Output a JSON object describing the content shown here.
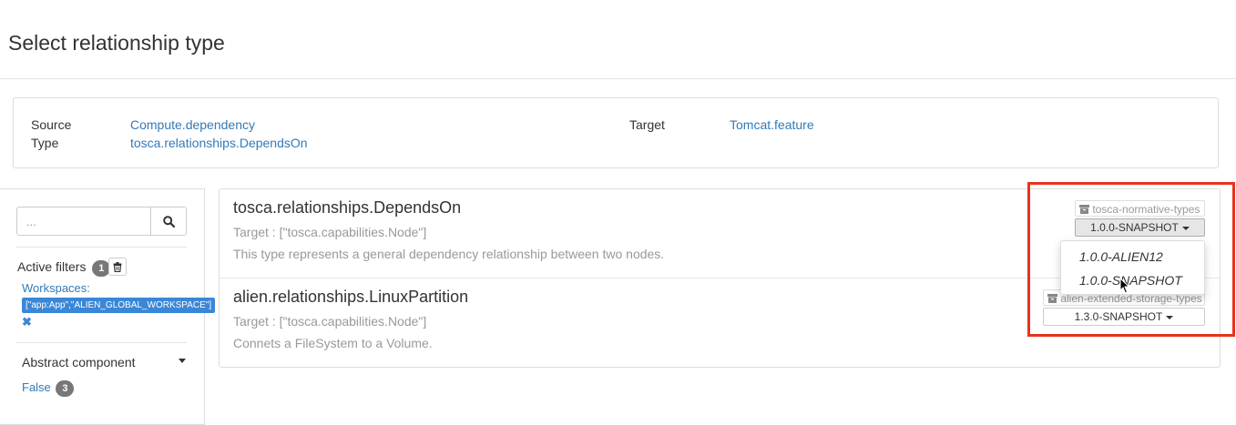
{
  "page": {
    "title": "Select relationship type"
  },
  "info": {
    "source_label": "Source",
    "source_value": "Compute.dependency",
    "type_label": "Type",
    "type_value": "tosca.relationships.DependsOn",
    "target_label": "Target",
    "target_value": "Tomcat.feature"
  },
  "sidebar": {
    "search_placeholder": "...",
    "active_filters_label": "Active filters",
    "active_filters_count": "1",
    "workspaces_label": "Workspaces:",
    "workspaces_value": "[\"app:App\",\"ALIEN_GLOBAL_WORKSPACE\"]",
    "remove_glyph": "✖",
    "abstract_label": "Abstract component",
    "false_label": "False",
    "false_count": "3"
  },
  "results": [
    {
      "name": "tosca.relationships.DependsOn",
      "target": "Target : [\"tosca.capabilities.Node\"]",
      "description": "This type represents a general dependency relationship between two nodes.",
      "archive": "tosca-normative-types",
      "version": "1.0.0-SNAPSHOT"
    },
    {
      "name": "alien.relationships.LinuxPartition",
      "target": "Target : [\"tosca.capabilities.Node\"]",
      "description": "Connets a FileSystem to a Volume.",
      "archive": "alien-extended-storage-types",
      "version": "1.3.0-SNAPSHOT"
    }
  ],
  "version_dropdown": {
    "options": [
      "1.0.0-ALIEN12",
      "1.0.0-SNAPSHOT"
    ]
  },
  "colors": {
    "link": "#337ab7",
    "highlight": "#e8321c",
    "tag_blue": "#3a87d7",
    "badge": "#777777"
  }
}
